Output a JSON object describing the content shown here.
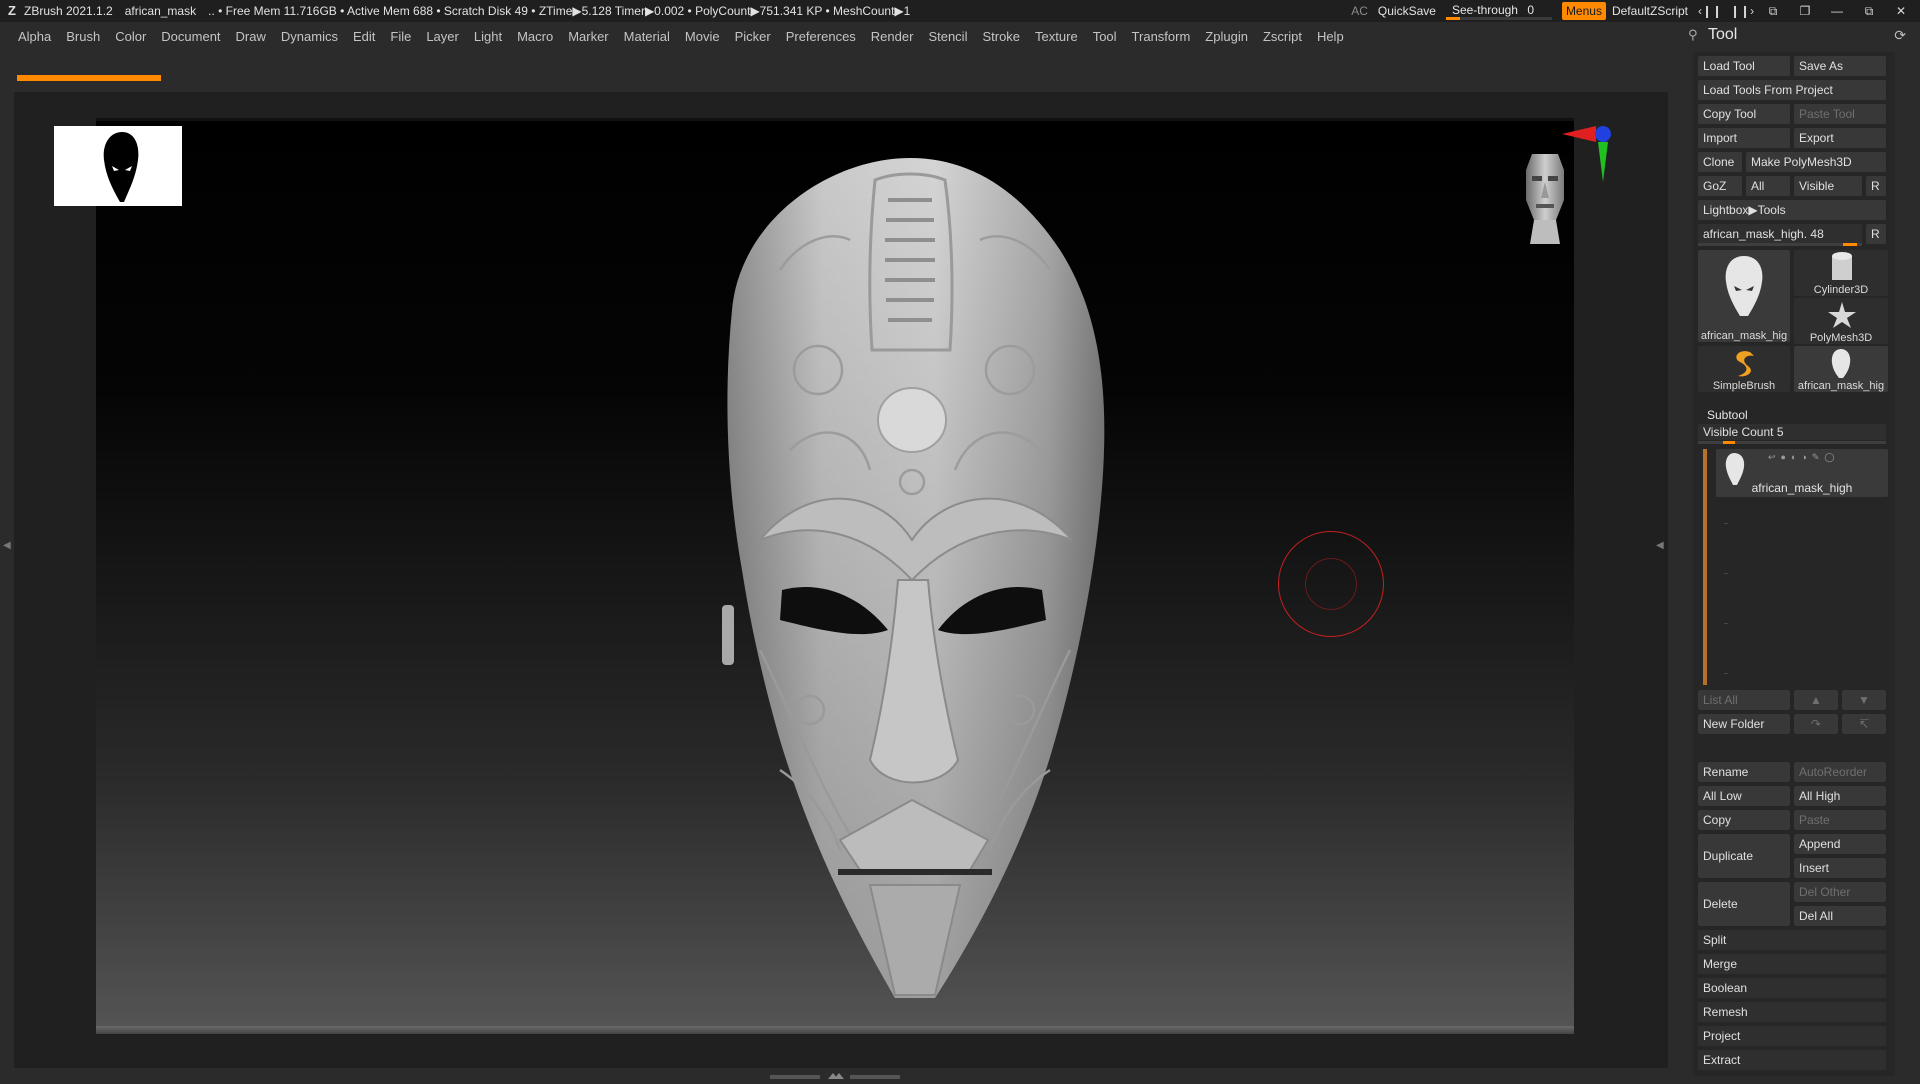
{
  "titlebar": {
    "app": "ZBrush 2021.1.2",
    "document": "african_mask",
    "status": "..  • Free Mem 11.716GB • Active Mem 688 • Scratch Disk 49 •  ZTime▶5.128 Timer▶0.002 • PolyCount▶751.341 KP  • MeshCount▶1",
    "ac": "AC",
    "quicksave": "QuickSave",
    "seethrough_label": "See-through",
    "seethrough_value": "0",
    "menus": "Menus",
    "zscript": "DefaultZScript",
    "icons": [
      "layout-left-icon",
      "layout-right-icon",
      "windows-icon",
      "palette-icon",
      "minimize-icon",
      "maximize-icon",
      "close-icon"
    ]
  },
  "menubar": {
    "items": [
      "Alpha",
      "Brush",
      "Color",
      "Document",
      "Draw",
      "Dynamics",
      "Edit",
      "File",
      "Layer",
      "Light",
      "Macro",
      "Marker",
      "Material",
      "Movie",
      "Picker",
      "Preferences",
      "Render",
      "Stencil",
      "Stroke",
      "Texture",
      "Tool",
      "Transform",
      "Zplugin",
      "Zscript",
      "Help"
    ]
  },
  "canvas": {
    "progress": 1.0,
    "accent": "#ff8a00",
    "cursor_color": "#c52020"
  },
  "tool_palette": {
    "title": "Tool",
    "load_tool": "Load Tool",
    "save_as": "Save As",
    "load_from_project": "Load Tools From Project",
    "copy_tool": "Copy Tool",
    "paste_tool": "Paste Tool",
    "import": "Import",
    "export": "Export",
    "clone": "Clone",
    "make_polymesh": "Make PolyMesh3D",
    "goz": "GoZ",
    "all": "All",
    "visible": "Visible",
    "r": "R",
    "lightbox_tools": "Lightbox▶Tools",
    "current_tool": "african_mask_high. 48",
    "current_tool_r": "R",
    "tools": [
      {
        "label": "african_mask_hig",
        "icon": "mask-icon"
      },
      {
        "label": "Cylinder3D",
        "icon": "cylinder-icon"
      },
      {
        "label": "PolyMesh3D",
        "icon": "star-icon"
      },
      {
        "label": "SimpleBrush",
        "icon": "simplebrush-icon"
      },
      {
        "label": "african_mask_hig",
        "icon": "mask-icon"
      }
    ]
  },
  "subtool": {
    "title": "Subtool",
    "visible_count": "Visible Count 5",
    "item_label": "african_mask_high",
    "list_all": "List All",
    "new_folder": "New Folder",
    "rename": "Rename",
    "auto_reorder": "AutoReorder",
    "all_low": "All Low",
    "all_high": "All High",
    "copy": "Copy",
    "paste": "Paste",
    "duplicate": "Duplicate",
    "append": "Append",
    "insert": "Insert",
    "delete": "Delete",
    "del_other": "Del Other",
    "del_all": "Del All",
    "split": "Split",
    "merge": "Merge",
    "boolean": "Boolean",
    "remesh": "Remesh",
    "project": "Project",
    "extract": "Extract"
  }
}
